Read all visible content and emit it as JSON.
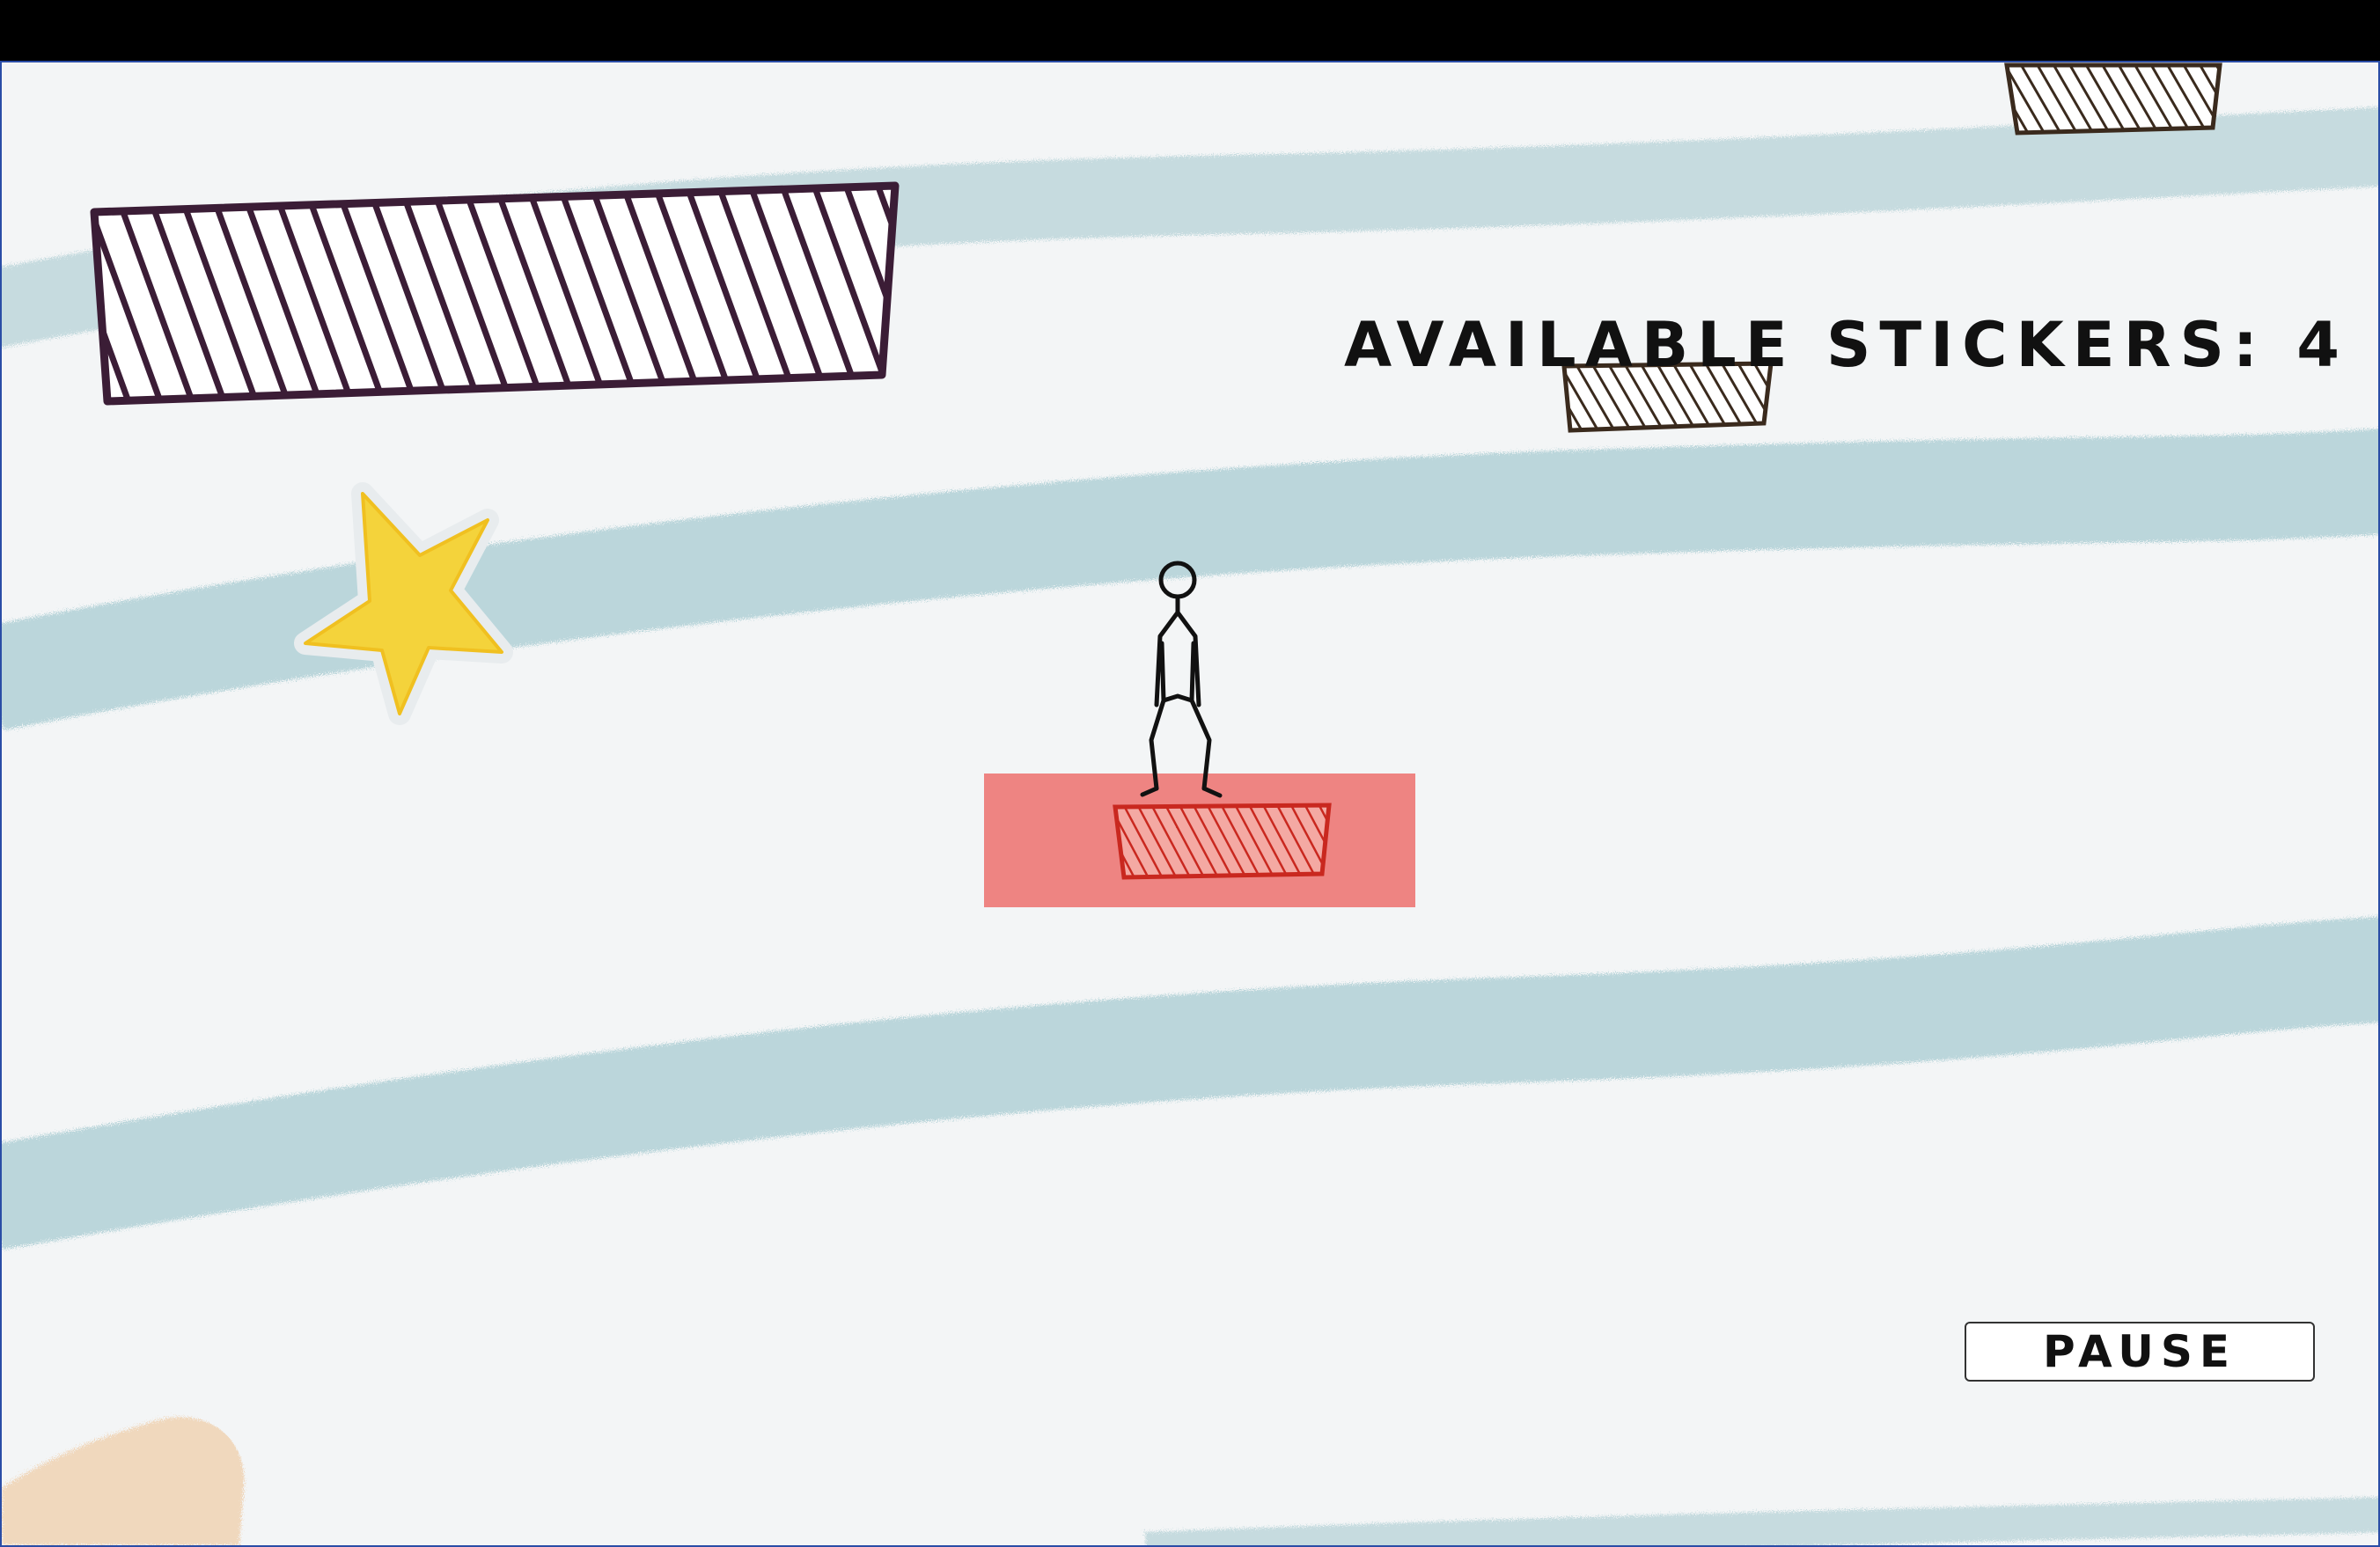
{
  "hud": {
    "stickers_label": "AVAILABLE STICKERS: 4"
  },
  "controls": {
    "pause_label": "PAUSE"
  },
  "colors": {
    "background": "#f3f5f6",
    "crayon_stripe": "#a9ccd3",
    "platform_purple": "#3b1d36",
    "platform_brown": "#3a2a1d",
    "platform_red": "#d63a2e",
    "selection_highlight": "#ee8482",
    "star": "#f4d33b",
    "peach_blob": "#f0d1b0"
  },
  "icons": [
    "star-icon",
    "stick-figure-icon"
  ]
}
